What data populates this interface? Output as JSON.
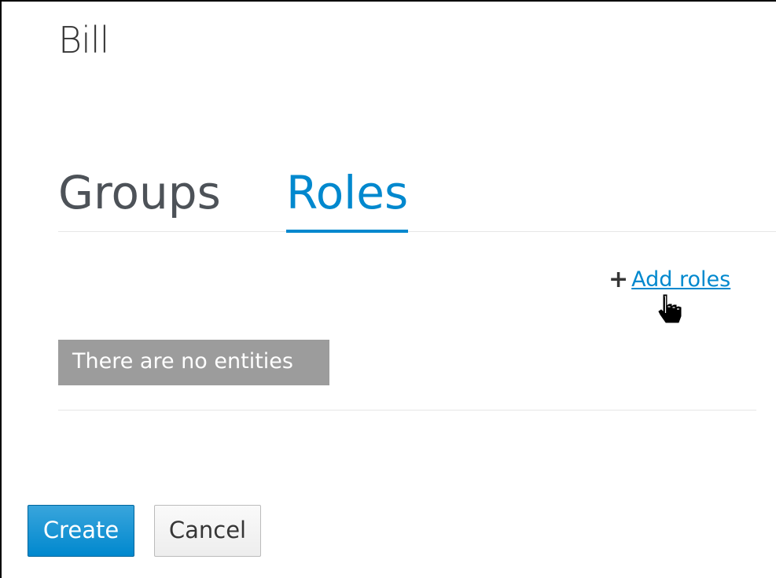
{
  "page": {
    "title": "Bill"
  },
  "tabs": [
    {
      "label": "Groups",
      "active": false
    },
    {
      "label": "Roles",
      "active": true
    }
  ],
  "roles": {
    "add_label": "Add roles",
    "empty_message": "There are no entities"
  },
  "actions": {
    "create_label": "Create",
    "cancel_label": "Cancel"
  },
  "colors": {
    "accent": "#0088ce",
    "empty_badge": "#9c9c9c",
    "text": "#363636"
  },
  "icons": {
    "add": "plus-icon",
    "pointer": "hand-pointer-icon"
  }
}
